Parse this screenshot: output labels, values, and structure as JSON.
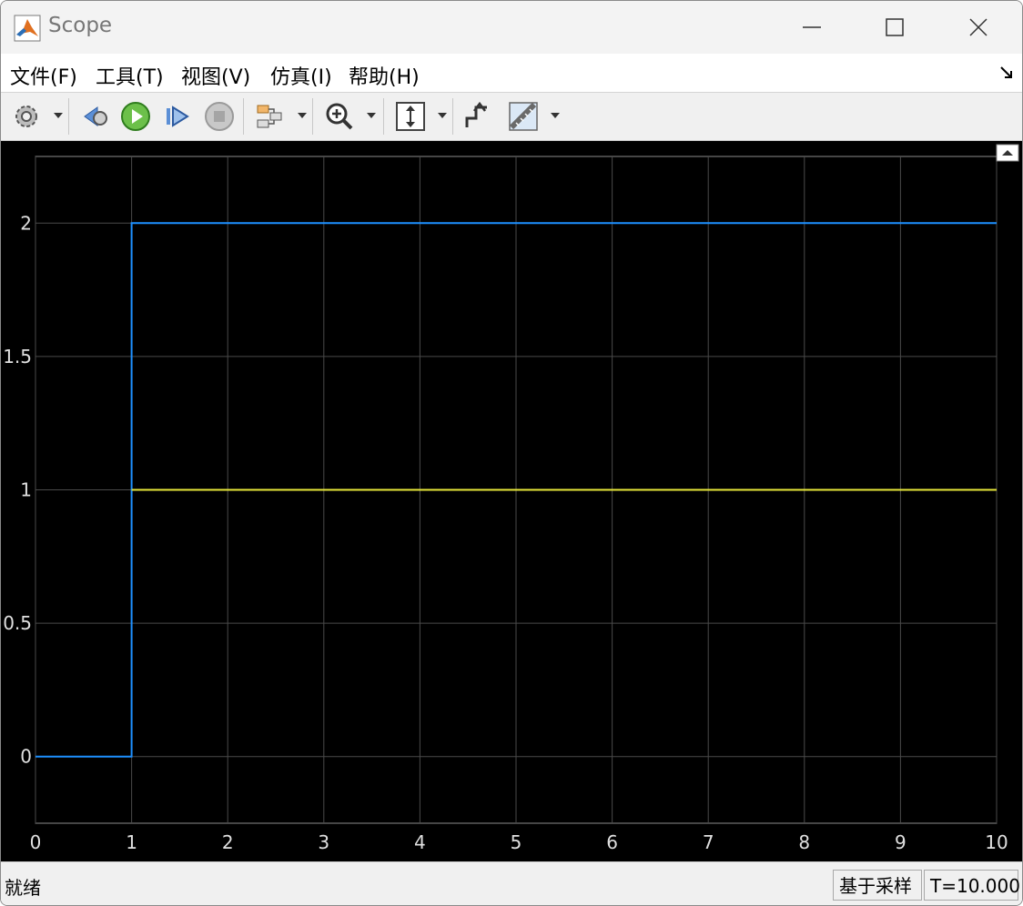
{
  "window": {
    "title": "Scope",
    "icon": "matlab-logo-icon"
  },
  "menu": [
    "文件(F)",
    "工具(T)",
    "视图(V)",
    "仿真(I)",
    "帮助(H)"
  ],
  "toolbar": {
    "icons": [
      "settings-gear-icon",
      "step-back-icon",
      "run-icon",
      "step-forward-icon",
      "stop-icon",
      "signal-select-icon",
      "zoom-in-icon",
      "autoscale-icon",
      "triggers-icon",
      "measure-icon"
    ]
  },
  "chart_data": {
    "type": "line",
    "xlim": [
      0,
      10
    ],
    "ylim": [
      -0.25,
      2.25
    ],
    "xticks": [
      "0",
      "1",
      "2",
      "3",
      "4",
      "5",
      "6",
      "7",
      "8",
      "9",
      "10"
    ],
    "yticks": [
      "0",
      "0.5",
      "1",
      "1.5",
      "2"
    ],
    "grid": true,
    "series": [
      {
        "color": "#1e90ff",
        "points": [
          [
            0,
            0
          ],
          [
            1,
            0
          ],
          [
            1,
            2
          ],
          [
            10,
            2
          ]
        ]
      },
      {
        "color": "#e8e83a",
        "points": [
          [
            1,
            1
          ],
          [
            10,
            1
          ]
        ]
      }
    ]
  },
  "status": {
    "text": "就绪",
    "mode": "基于采样",
    "time": "T=10.000"
  }
}
